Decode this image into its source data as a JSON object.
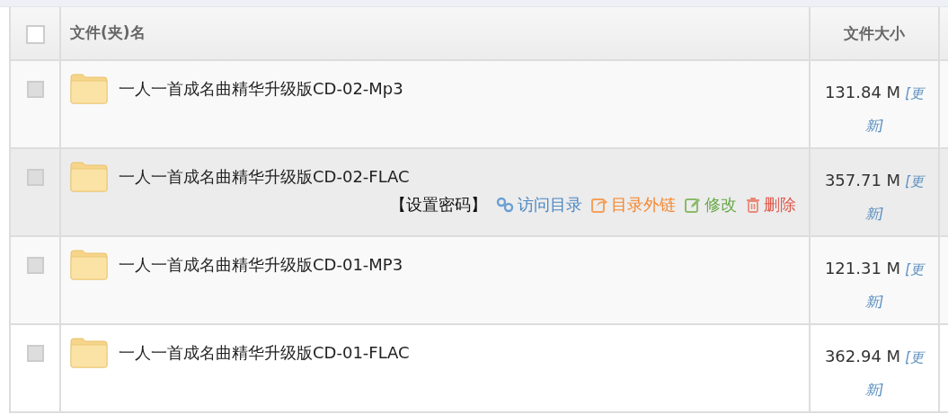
{
  "table": {
    "select_all": {
      "checked": false
    },
    "columns": [
      "文件(夹)名",
      "文件大小"
    ],
    "rows": [
      {
        "name": "一人一首成名曲精华升级版CD-02-Mp3",
        "size": "131.84 M",
        "refresh": "[更新]",
        "checked": false,
        "hovered": false
      },
      {
        "name": "一人一首成名曲精华升级版CD-02-FLAC",
        "size": "357.71 M",
        "refresh": "[更新]",
        "checked": false,
        "hovered": true,
        "actions": [
          {
            "kind": "password",
            "label": "【设置密码】"
          },
          {
            "kind": "visit",
            "label": "访问目录"
          },
          {
            "kind": "share",
            "label": "目录外链"
          },
          {
            "kind": "edit",
            "label": "修改"
          },
          {
            "kind": "delete",
            "label": "删除"
          }
        ]
      },
      {
        "name": "一人一首成名曲精华升级版CD-01-MP3",
        "size": "121.31 M",
        "refresh": "[更新]",
        "checked": false,
        "hovered": false
      },
      {
        "name": "一人一首成名曲精华升级版CD-01-FLAC",
        "size": "362.94 M",
        "refresh": "[更新]",
        "checked": false,
        "hovered": false
      }
    ]
  }
}
